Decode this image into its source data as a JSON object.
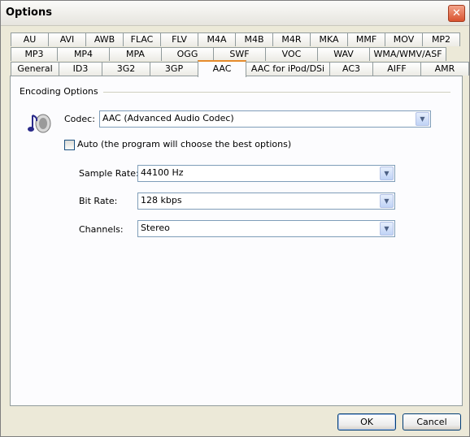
{
  "window": {
    "title": "Options",
    "close_icon": "close-icon"
  },
  "tabs": {
    "row1": [
      "AU",
      "AVI",
      "AWB",
      "FLAC",
      "FLV",
      "M4A",
      "M4B",
      "M4R",
      "MKA",
      "MMF",
      "MOV",
      "MP2"
    ],
    "row2": [
      "MP3",
      "MP4",
      "MPA",
      "OGG",
      "SWF",
      "VOC",
      "WAV",
      "WMA/WMV/ASF"
    ],
    "row3": [
      "General",
      "ID3",
      "3G2",
      "3GP",
      "AAC",
      "AAC for iPod/DSi",
      "AC3",
      "AIFF",
      "AMR"
    ],
    "selected": "AAC"
  },
  "encoding": {
    "group_label": "Encoding Options",
    "codec_label": "Codec:",
    "codec_value": "AAC (Advanced Audio Codec)",
    "auto_checked": false,
    "auto_label": "Auto (the program will choose the best options)",
    "sample_rate_label": "Sample Rate:",
    "sample_rate_value": "44100 Hz",
    "bit_rate_label": "Bit Rate:",
    "bit_rate_value": "128 kbps",
    "channels_label": "Channels:",
    "channels_value": "Stereo"
  },
  "buttons": {
    "ok": "OK",
    "cancel": "Cancel"
  },
  "colors": {
    "selected_tab_accent": "#e68b2c",
    "close_button": "#d9522f"
  }
}
